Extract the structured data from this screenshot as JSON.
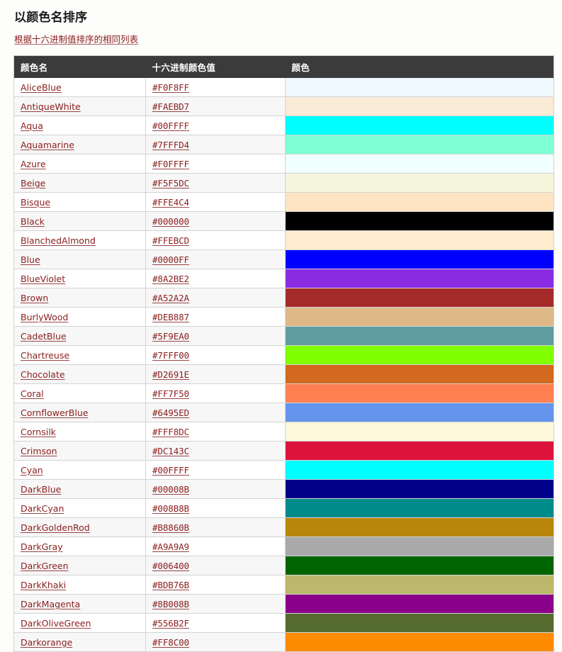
{
  "page": {
    "title": "以颜色名排序",
    "subtitle_link": "根据十六进制值排序的相同列表",
    "background_color": "#fdfdfb",
    "link_color": "#8b2020",
    "header_bg_color": "#3b3b3b",
    "header_text_color": "#ffffff"
  },
  "table": {
    "columns": [
      {
        "label": "颜色名",
        "key": "name"
      },
      {
        "label": "十六进制颜色值",
        "key": "hex"
      },
      {
        "label": "颜色",
        "key": "swatch"
      }
    ],
    "rows": [
      {
        "name": "AliceBlue",
        "hex": "#F0F8FF"
      },
      {
        "name": "AntiqueWhite",
        "hex": "#FAEBD7"
      },
      {
        "name": "Aqua",
        "hex": "#00FFFF"
      },
      {
        "name": "Aquamarine",
        "hex": "#7FFFD4"
      },
      {
        "name": "Azure",
        "hex": "#F0FFFF"
      },
      {
        "name": "Beige",
        "hex": "#F5F5DC"
      },
      {
        "name": "Bisque",
        "hex": "#FFE4C4"
      },
      {
        "name": "Black",
        "hex": "#000000"
      },
      {
        "name": "BlanchedAlmond",
        "hex": "#FFEBCD"
      },
      {
        "name": "Blue",
        "hex": "#0000FF"
      },
      {
        "name": "BlueViolet",
        "hex": "#8A2BE2"
      },
      {
        "name": "Brown",
        "hex": "#A52A2A"
      },
      {
        "name": "BurlyWood",
        "hex": "#DEB887"
      },
      {
        "name": "CadetBlue",
        "hex": "#5F9EA0"
      },
      {
        "name": "Chartreuse",
        "hex": "#7FFF00"
      },
      {
        "name": "Chocolate",
        "hex": "#D2691E"
      },
      {
        "name": "Coral",
        "hex": "#FF7F50"
      },
      {
        "name": "CornflowerBlue",
        "hex": "#6495ED"
      },
      {
        "name": "Cornsilk",
        "hex": "#FFF8DC"
      },
      {
        "name": "Crimson",
        "hex": "#DC143C"
      },
      {
        "name": "Cyan",
        "hex": "#00FFFF"
      },
      {
        "name": "DarkBlue",
        "hex": "#00008B"
      },
      {
        "name": "DarkCyan",
        "hex": "#008B8B"
      },
      {
        "name": "DarkGoldenRod",
        "hex": "#B8860B"
      },
      {
        "name": "DarkGray",
        "hex": "#A9A9A9"
      },
      {
        "name": "DarkGreen",
        "hex": "#006400"
      },
      {
        "name": "DarkKhaki",
        "hex": "#BDB76B"
      },
      {
        "name": "DarkMagenta",
        "hex": "#8B008B"
      },
      {
        "name": "DarkOliveGreen",
        "hex": "#556B2F"
      },
      {
        "name": "Darkorange",
        "hex": "#FF8C00"
      }
    ]
  }
}
